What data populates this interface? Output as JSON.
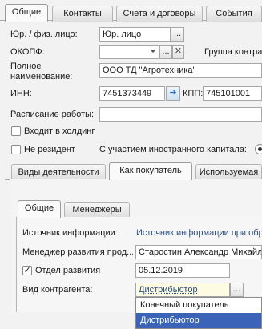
{
  "tabs_top": [
    {
      "label": "Общие"
    },
    {
      "label": "Контакты"
    },
    {
      "label": "Счета и договоры"
    },
    {
      "label": "События"
    }
  ],
  "form": {
    "legal_type_label": "Юр. / физ. лицо:",
    "legal_type_value": "Юр. лицо",
    "okopf_label": "ОКОПФ:",
    "okopf_value": "",
    "group_label": "Группа контра",
    "full_name_label_1": "Полное",
    "full_name_label_2": "наименование:",
    "full_name_value": "ООО ТД \"Агротехника\"",
    "inn_label": "ИНН:",
    "inn_value": "7451373449",
    "kpp_label": "КПП:",
    "kpp_value": "745101001",
    "schedule_label": "Расписание работы:",
    "schedule_value": "",
    "holding_label": "Входит в холдинг",
    "nonresident_label": "Не резидент",
    "foreign_capital_label": "С участием иностранного капитала:"
  },
  "tabs_mid": [
    {
      "label": "Виды деятельности"
    },
    {
      "label": "Как покупатель"
    },
    {
      "label": "Используемая"
    }
  ],
  "tabs_inner": [
    {
      "label": "Общие"
    },
    {
      "label": "Менеджеры"
    }
  ],
  "buyer": {
    "source_label": "Источник информации:",
    "source_value": "Источник информации при обра",
    "manager_label": "Менеджер развития прод...",
    "manager_value": "Старостин Александр Михайло",
    "dept_label": "Отдел развития",
    "dept_checked": true,
    "date_value": "05.12.2019",
    "kind_label": "Вид контрагента:",
    "kind_value": "Дистрибьютор",
    "kind_options": [
      "Конечный покупатель",
      "Дистрибьютор"
    ],
    "kind_selected_index": 1
  },
  "buttons": {
    "ellipsis": "...",
    "clear": "✕",
    "arrow": "➜",
    "check": "✓"
  }
}
